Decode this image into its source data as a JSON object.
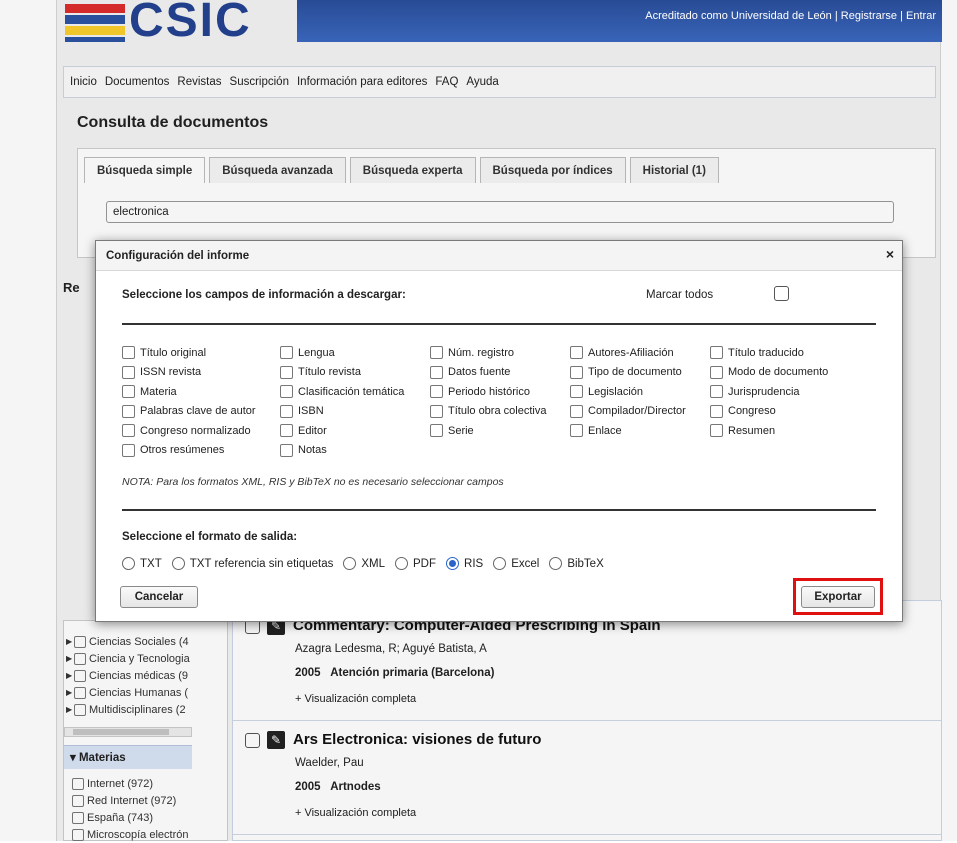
{
  "header": {
    "logo_text": "CSIC",
    "top_links": [
      "Acreditado como Universidad de León",
      "Registrarse",
      "Entrar"
    ],
    "flag_colors": [
      "#d42a2a",
      "#2a4f9c",
      "#f0c62a",
      "#2a4f9c"
    ]
  },
  "nav": {
    "items": [
      "Inicio",
      "Documentos",
      "Revistas",
      "Suscripción",
      "Información para editores",
      "FAQ",
      "Ayuda"
    ]
  },
  "page_title": "Consulta de documentos",
  "search_tabs": [
    "Búsqueda simple",
    "Búsqueda avanzada",
    "Búsqueda experta",
    "Búsqueda por índices",
    "Historial (1)"
  ],
  "search": {
    "value": "electronica"
  },
  "results_peek_label": "Re",
  "left_sidebar": {
    "facets": [
      "Ciencias Sociales (4",
      "Ciencia y Tecnologia",
      "Ciencias médicas (9",
      "Ciencias Humanas (",
      "Multidisciplinares (2"
    ],
    "materias_title": "Materias",
    "materias": [
      "Internet (972)",
      "Red Internet (972)",
      "España (743)",
      "Microscopía electrón"
    ]
  },
  "results": [
    {
      "title": "Commentary: Computer-Aided Prescribing in Spain",
      "authors": "Azagra Ledesma, R; Aguyé Batista, A",
      "year": "2005",
      "source": "Atención primaria (Barcelona)",
      "full_view": "+ Visualización completa"
    },
    {
      "title": "Ars Electronica: visiones de futuro",
      "authors": "Waelder, Pau",
      "year": "2005",
      "source": "Artnodes",
      "full_view": "+ Visualización completa"
    }
  ],
  "modal": {
    "title": "Configuración del informe",
    "close": "×",
    "fields_prompt": "Seleccione los campos de información a descargar:",
    "mark_all": "Marcar todos",
    "columns": [
      [
        "Título original",
        "ISSN revista",
        "Materia",
        "Palabras clave de autor",
        "Congreso normalizado",
        "Otros resúmenes"
      ],
      [
        "Lengua",
        "Título revista",
        "Clasificación temática",
        "ISBN",
        "Editor",
        "Notas"
      ],
      [
        "Núm. registro",
        "Datos fuente",
        "Periodo histórico",
        "Título obra colectiva",
        "Serie"
      ],
      [
        "Autores-Afiliación",
        "Tipo de documento",
        "Legislación",
        "Compilador/Director",
        "Enlace"
      ],
      [
        "Título traducido",
        "Modo de documento",
        "Jurisprudencia",
        "Congreso",
        "Resumen"
      ]
    ],
    "note": "NOTA: Para los formatos XML, RIS y BibTeX no es necesario seleccionar campos",
    "format_prompt": "Seleccione el formato de salida:",
    "formats": [
      "TXT",
      "TXT referencia sin etiquetas",
      "XML",
      "PDF",
      "RIS",
      "Excel",
      "BibTeX"
    ],
    "selected_format": "RIS",
    "cancel_label": "Cancelar",
    "export_label": "Exportar"
  },
  "colors": {
    "accent": "#2a64c8",
    "highlight": "#e01010",
    "header_blue": "#2a4f9c"
  }
}
